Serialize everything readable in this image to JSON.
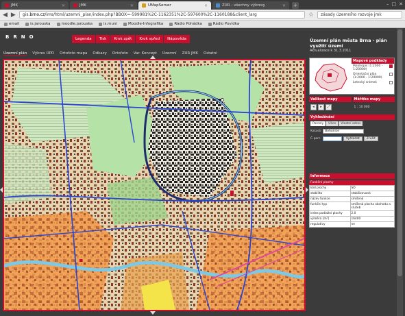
{
  "browser": {
    "tabs": [
      {
        "label": "JMK"
      },
      {
        "label": "JMK"
      },
      {
        "label": "UMapServer",
        "active": true
      },
      {
        "label": "ZÚR - všechny výkresy"
      }
    ],
    "new_tab": "+",
    "url_prefix": "gis.",
    "url_host": "brno.cz",
    "url_rest": "/ims/html/uzemni_plan/index.php?BBOX=-599981%2C-1162351%2C-597600%2C-1160188&client_larg",
    "search": "zásady územního rozvoje jmk",
    "bookmarks": [
      "email",
      "is.jarouska",
      "moodle.jarouska",
      "is.muni",
      "Moodle-Infografika",
      "Rádio Pohádka",
      "Rádio Povídka"
    ]
  },
  "page": {
    "logo": "BRNO",
    "main_nav": [
      "Legenda",
      "Tisk",
      "Krok zpět",
      "Krok vpřed",
      "Nápověda"
    ],
    "sub_nav": [
      "Územní plán",
      "Výkres ÚPD",
      "Ortofoto mapa",
      "Odkazy",
      "Ortofoto",
      "Var. Koncept",
      "Územní",
      "ZÚR JMK",
      "Ostatní"
    ],
    "title": "Územní plán města Brna - plán využití území",
    "updated": "Aktualizace k 31.3.2011"
  },
  "overview": {
    "layers_title": "Mapové podklady",
    "layers": [
      {
        "label": "Polohopis (1:2000 - 1:20000)",
        "checked": true
      },
      {
        "label": "Orientační plán (1:2000 - 1:20000)",
        "checked": false
      },
      {
        "label": "Letecký snímek",
        "checked": false
      }
    ]
  },
  "tools": {
    "size_title": "Velikost mapy",
    "scale_title": "Měřítko mapy",
    "scale_value": "1 : 10 000"
  },
  "search": {
    "title": "Vyhledávání",
    "tabs": [
      "Parcely",
      "Ulice",
      "Vlastní adres"
    ],
    "katastr_label": "Katastr",
    "katastr_value": "Bohunice",
    "parcel_label": "Č.parc.",
    "find_button": "Vyhledat",
    "reset_button": "Zrušit"
  },
  "info": {
    "title": "Informace",
    "subtitle": "Funkční plochy",
    "rows": [
      {
        "k": "kód plochy",
        "v": "SO"
      },
      {
        "k": "stabilita",
        "v": "stabilizovaná"
      },
      {
        "k": "název funkce",
        "v": "smíšená"
      },
      {
        "k": "funkční typ",
        "v": "smíšená plocha obchodu a služeb"
      },
      {
        "k": "index podlažní plochy",
        "v": "2.0"
      },
      {
        "k": "výměra [m²]",
        "v": "16400"
      },
      {
        "k": "regulativy",
        "v": "ne"
      }
    ]
  },
  "colors": {
    "accent": "#c8102e",
    "panel_dark": "#3b3b3b",
    "map_green": "#b5e2a7",
    "map_orange": "#f29a4a",
    "road_blue": "#2a45d0"
  }
}
